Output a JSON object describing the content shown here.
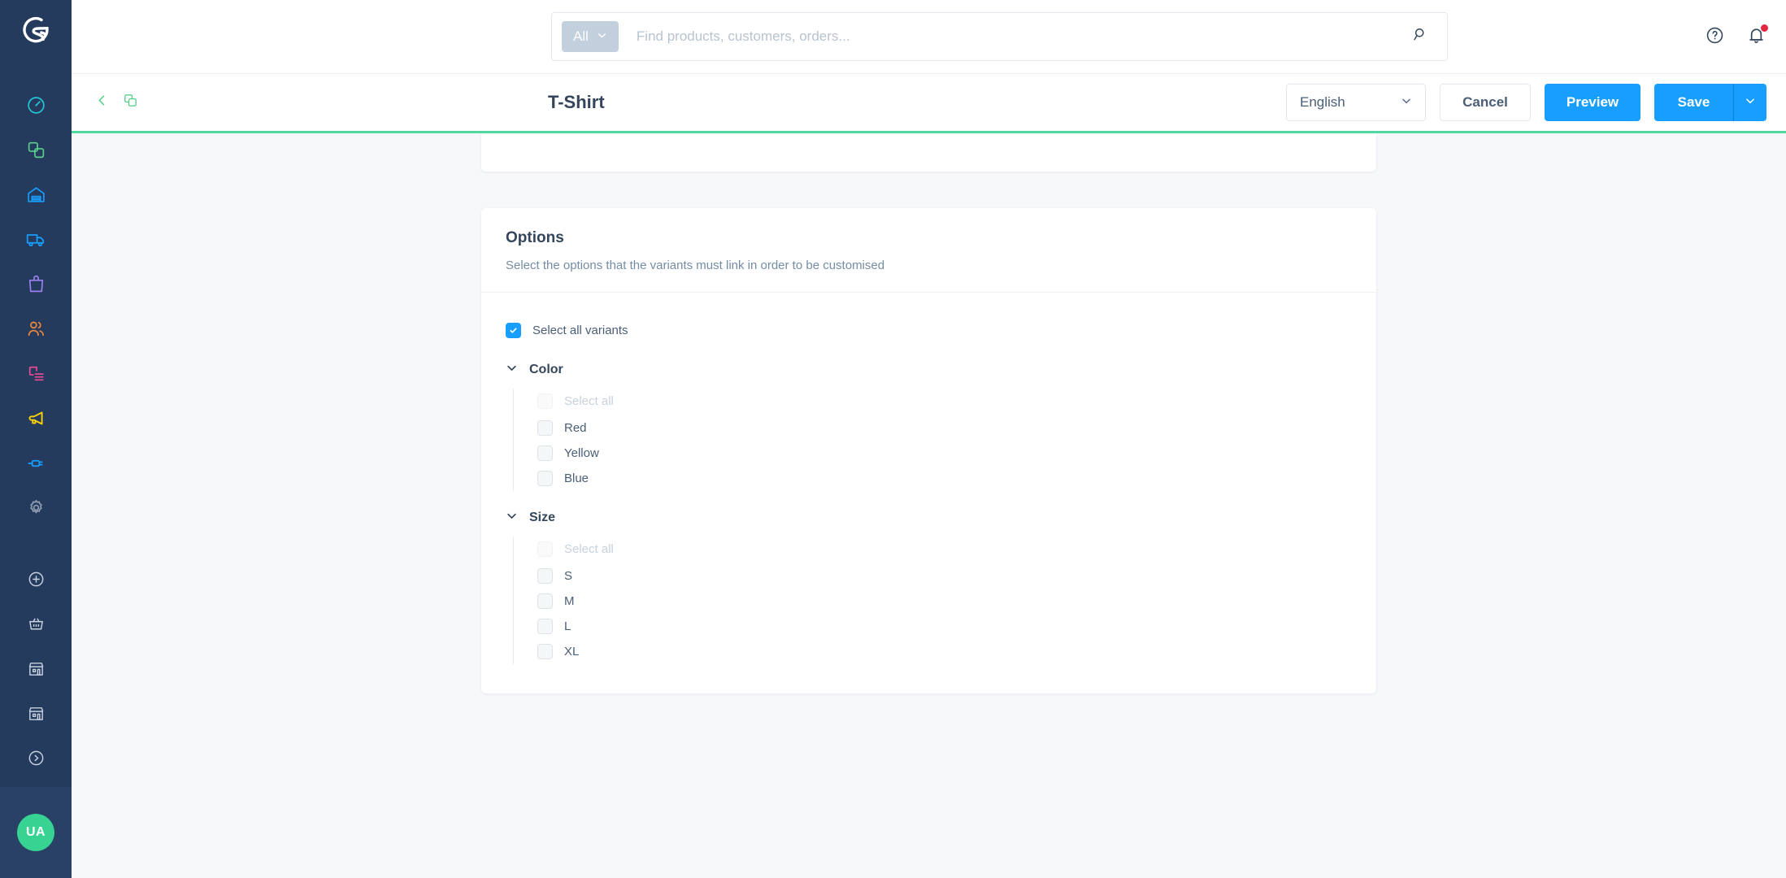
{
  "brand": {
    "name": "Shopware",
    "logo_icon": "shopware-logo-icon"
  },
  "sidebar": {
    "items": [
      {
        "icon": "dashboard-speedometer-icon",
        "label": "Dashboard",
        "color": "#26c5d6"
      },
      {
        "icon": "catalogues-copy-icon",
        "label": "Catalogues",
        "color": "#5ad08d"
      },
      {
        "icon": "warehouse-icon",
        "label": "Orders",
        "color": "#189eff"
      },
      {
        "icon": "truck-delivery-icon",
        "label": "Deliveries",
        "color": "#189eff"
      },
      {
        "icon": "shopping-bag-icon",
        "label": "Products",
        "color": "#9b7ff0"
      },
      {
        "icon": "customers-users-icon",
        "label": "Customers",
        "color": "#f08a3c"
      },
      {
        "icon": "content-document-icon",
        "label": "Content",
        "color": "#ef4a93"
      },
      {
        "icon": "megaphone-marketing-icon",
        "label": "Marketing",
        "color": "#ffd300"
      },
      {
        "icon": "plug-extensions-icon",
        "label": "Extensions",
        "color": "#189eff"
      },
      {
        "icon": "gear-settings-icon",
        "label": "Settings",
        "color": "#8f9eb2"
      }
    ],
    "shortcuts": [
      {
        "icon": "plus-circle-icon",
        "label": "Add"
      },
      {
        "icon": "basket-icon",
        "label": "Basket"
      },
      {
        "icon": "storefront-icon",
        "label": "Storefront"
      },
      {
        "icon": "storefront-second-icon",
        "label": "Sales channel"
      },
      {
        "icon": "chevron-right-circle-icon",
        "label": "Expand"
      }
    ],
    "avatar": {
      "initials": "UA",
      "color": "#37d392"
    }
  },
  "header": {
    "search": {
      "scope_label": "All",
      "scope_icon": "chevron-down-icon",
      "value": "",
      "placeholder": "Find products, customers, orders...",
      "search_icon": "search-icon"
    },
    "help_icon": "help-circle-icon",
    "notifications_icon": "bell-icon",
    "notifications_has_unread": true
  },
  "toolbar": {
    "back_icon": "chevron-left-icon",
    "duplicate_icon": "copy-duplicate-icon",
    "title": "T-Shirt",
    "language_value": "English",
    "language_icon": "chevron-down-icon",
    "cancel_label": "Cancel",
    "preview_label": "Preview",
    "save_label": "Save",
    "save_more_icon": "chevron-down-icon"
  },
  "progress": {
    "color": "#53d7a0",
    "percent": 100
  },
  "options_card": {
    "title": "Options",
    "subtitle": "Select the options that the variants must link in order to be customised",
    "select_all_variants": {
      "label": "Select all variants",
      "checked": true
    },
    "groups": [
      {
        "name": "Color",
        "expanded": true,
        "collapse_icon": "chevron-down-icon",
        "select_all": {
          "label": "Select all",
          "checked": false,
          "disabled": true
        },
        "values": [
          {
            "label": "Red",
            "checked": false
          },
          {
            "label": "Yellow",
            "checked": false
          },
          {
            "label": "Blue",
            "checked": false
          }
        ]
      },
      {
        "name": "Size",
        "expanded": true,
        "collapse_icon": "chevron-down-icon",
        "select_all": {
          "label": "Select all",
          "checked": false,
          "disabled": true
        },
        "values": [
          {
            "label": "S",
            "checked": false
          },
          {
            "label": "M",
            "checked": false
          },
          {
            "label": "L",
            "checked": false
          },
          {
            "label": "XL",
            "checked": false
          }
        ]
      }
    ]
  },
  "colors": {
    "sidebar_bg": "#243b5e",
    "accent_blue": "#189eff",
    "accent_green": "#53d7a0",
    "content_bg": "#f7f8fa",
    "text_dark": "#34455c",
    "text_muted": "#758ca5",
    "badge_red": "#e3263f"
  }
}
